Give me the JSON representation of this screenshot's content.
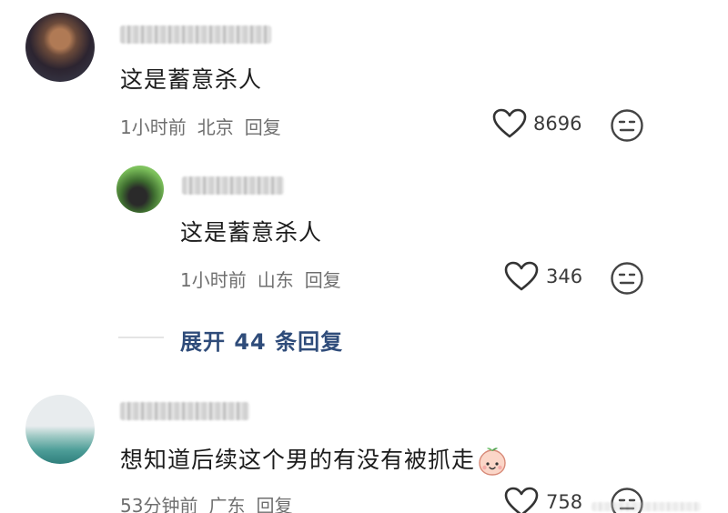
{
  "comments": [
    {
      "text": "这是蓄意杀人",
      "time": "1小时前",
      "location": "北京",
      "reply_label": "回复",
      "likes": "8696",
      "replies": [
        {
          "text": "这是蓄意杀人",
          "time": "1小时前",
          "location": "山东",
          "reply_label": "回复",
          "likes": "346"
        }
      ],
      "expand_label": "展开 44 条回复"
    },
    {
      "text": "想知道后续这个男的有没有被抓走",
      "time": "53分钟前",
      "location": "广东",
      "reply_label": "回复",
      "likes": "758"
    }
  ],
  "icons": {
    "like": "heart-outline-icon",
    "dislike": "neutral-face-icon",
    "inline_emoji": "peach-face-emoji-icon"
  },
  "colors": {
    "expand_link": "#2f4c7a",
    "meta_text": "#6f6f6f",
    "primary_text": "#1c1c1c"
  }
}
